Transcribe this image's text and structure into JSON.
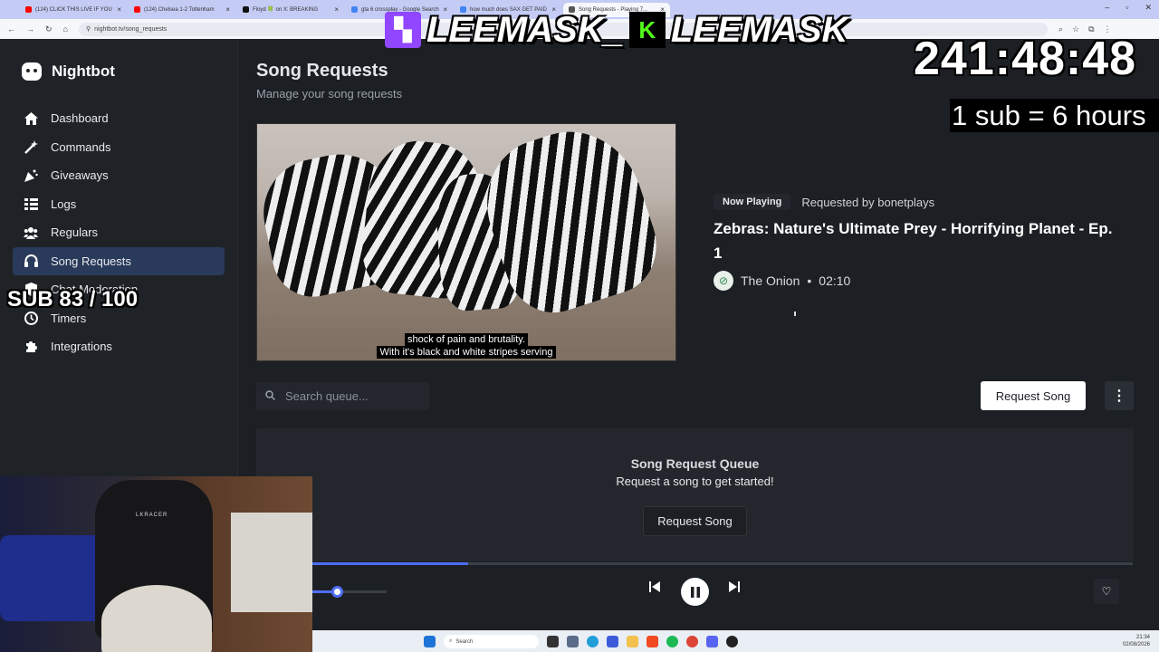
{
  "browser": {
    "tabs": [
      {
        "label": "(124) CLICK THIS LIVE IF YOU",
        "color": "#ff0000"
      },
      {
        "label": "(124) Chelsea 1-2 Tottenham",
        "color": "#ff0000"
      },
      {
        "label": "Floyd 🍀 on X: BREAKING",
        "color": "#111111"
      },
      {
        "label": "gta 6 crossplay - Google Search",
        "color": "#4285f4"
      },
      {
        "label": "how much does SAX GET PAID",
        "color": "#4285f4"
      },
      {
        "label": "Song Requests - Playing 7...",
        "color": "#555555"
      }
    ],
    "url": "nightbot.tv/song_requests"
  },
  "sidebar": {
    "brand": "Nightbot",
    "items": [
      {
        "label": "Dashboard",
        "icon": "home-icon"
      },
      {
        "label": "Commands",
        "icon": "wand-icon"
      },
      {
        "label": "Giveaways",
        "icon": "party-icon"
      },
      {
        "label": "Logs",
        "icon": "list-icon"
      },
      {
        "label": "Regulars",
        "icon": "users-icon"
      },
      {
        "label": "Song Requests",
        "icon": "headphones-icon",
        "active": true
      },
      {
        "label": "Chat Moderation",
        "icon": "shield-icon"
      },
      {
        "label": "Timers",
        "icon": "clock-icon"
      },
      {
        "label": "Integrations",
        "icon": "puzzle-icon"
      }
    ]
  },
  "page": {
    "title": "Song Requests",
    "subtitle": "Manage your song requests"
  },
  "video": {
    "caption_line1": "shock of pain and brutality.",
    "caption_line2": "With it's black and white stripes serving"
  },
  "now_playing": {
    "badge": "Now Playing",
    "requested_by": "Requested by bonetplays",
    "title": "Zebras: Nature's Ultimate Prey - Horrifying Planet - Ep. 1",
    "channel": "The Onion",
    "separator": "•",
    "duration": "02:10"
  },
  "queue": {
    "search_placeholder": "Search queue...",
    "request_button": "Request Song",
    "title": "Song Request Queue",
    "empty_text": "Request a song to get started!",
    "empty_button": "Request Song"
  },
  "player": {
    "progress": 0.19,
    "volume": 0.33
  },
  "taskbar": {
    "search_placeholder": "Search",
    "time": "21:34",
    "date": "02/08/2026"
  },
  "overlay": {
    "name1": "LEEMASK_",
    "name2": "LEEMASK",
    "timer": "241:48:48",
    "sub_rate": "1 sub = 6 hours",
    "sub_goal": "SUB 83 / 100"
  },
  "webcam": {
    "chair_brand": "LKRACER"
  },
  "colors": {
    "accent": "#4f6ef7",
    "active_nav": "#2a3a5a",
    "twitch": "#9146ff",
    "kick": "#53fc18"
  }
}
